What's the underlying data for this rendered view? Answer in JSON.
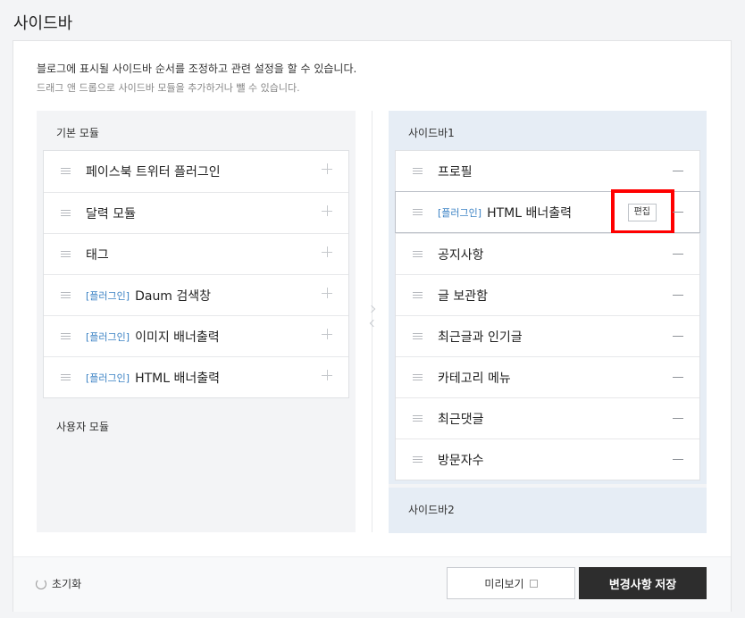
{
  "page": {
    "title": "사이드바"
  },
  "description": {
    "line1": "블로그에 표시될 사이드바 순서를 조정하고 관련 설정을 할 수 있습니다.",
    "line2": "드래그 앤 드롭으로 사이드바 모듈을 추가하거나 뺄 수 있습니다."
  },
  "left": {
    "basic_title": "기본 모듈",
    "basic_items": [
      {
        "tag": "",
        "label": "페이스북 트위터 플러그인"
      },
      {
        "tag": "",
        "label": "달력 모듈"
      },
      {
        "tag": "",
        "label": "태그"
      },
      {
        "tag": "[플러그인]",
        "label": "Daum 검색창"
      },
      {
        "tag": "[플러그인]",
        "label": "이미지 배너출력"
      },
      {
        "tag": "[플러그인]",
        "label": "HTML 배너출력"
      }
    ],
    "user_title": "사용자 모듈"
  },
  "right": {
    "sidebar1_title": "사이드바1",
    "sidebar1_items": [
      {
        "tag": "",
        "label": "프로필"
      },
      {
        "tag": "[플러그인]",
        "label": "HTML 배너출력",
        "edit": "편집"
      },
      {
        "tag": "",
        "label": "공지사항"
      },
      {
        "tag": "",
        "label": "글 보관함"
      },
      {
        "tag": "",
        "label": "최근글과 인기글"
      },
      {
        "tag": "",
        "label": "카테고리 메뉴"
      },
      {
        "tag": "",
        "label": "최근댓글"
      },
      {
        "tag": "",
        "label": "방문자수"
      }
    ],
    "sidebar2_title": "사이드바2"
  },
  "footer": {
    "reset_label": "초기화",
    "preview_label": "미리보기",
    "save_label": "변경사항 저장"
  },
  "colors": {
    "tag": "#3b82c4",
    "save_bg": "#2d2d2d",
    "highlight": "#ff0000",
    "sidebar_bg": "#e6edf5"
  },
  "icons": [
    "drag-handle-icon",
    "plus-icon",
    "minus-icon",
    "refresh-icon",
    "external-link-icon",
    "chevron-right-icon",
    "chevron-left-icon"
  ]
}
